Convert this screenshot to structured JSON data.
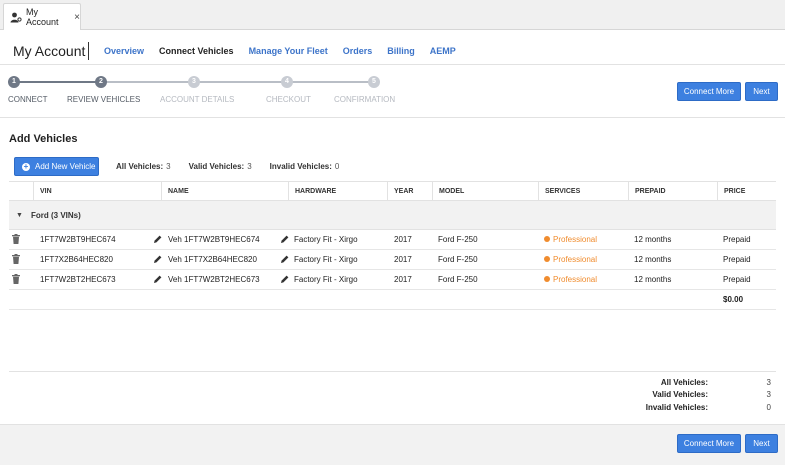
{
  "tab": {
    "label": "My Account",
    "close": "×"
  },
  "header": {
    "title": "My Account",
    "nav": [
      "Overview",
      "Connect Vehicles",
      "Manage Your Fleet",
      "Orders",
      "Billing",
      "AEMP"
    ]
  },
  "stepper": {
    "steps": [
      {
        "num": "1",
        "label": "CONNECT"
      },
      {
        "num": "2",
        "label": "REVIEW VEHICLES"
      },
      {
        "num": "3",
        "label": "ACCOUNT DETAILS"
      },
      {
        "num": "4",
        "label": "CHECKOUT"
      },
      {
        "num": "5",
        "label": "CONFIRMATION"
      }
    ]
  },
  "actions": {
    "connect_more": "Connect More",
    "next": "Next"
  },
  "section": {
    "title": "Add Vehicles",
    "add_button": "Add New Vehicle",
    "counts": {
      "all_label": "All Vehicles:",
      "all": "3",
      "valid_label": "Valid Vehicles:",
      "valid": "3",
      "invalid_label": "Invalid Vehicles:",
      "invalid": "0"
    }
  },
  "table": {
    "headers": [
      "VIN",
      "NAME",
      "HARDWARE",
      "YEAR",
      "MODEL",
      "SERVICES",
      "PREPAID",
      "PRICE"
    ],
    "group": "Ford (3 VINs)",
    "rows": [
      {
        "vin": "1FT7W2BT9HEC674",
        "name": "Veh 1FT7W2BT9HEC674",
        "hardware": "Factory Fit - Xirgo",
        "year": "2017",
        "model": "Ford F-250",
        "services": "Professional",
        "prepaid": "12 months",
        "price": "Prepaid"
      },
      {
        "vin": "1FT7X2B64HEC820",
        "name": "Veh 1FT7X2B64HEC820",
        "hardware": "Factory Fit - Xirgo",
        "year": "2017",
        "model": "Ford F-250",
        "services": "Professional",
        "prepaid": "12 months",
        "price": "Prepaid"
      },
      {
        "vin": "1FT7W2BT2HEC673",
        "name": "Veh 1FT7W2BT2HEC673",
        "hardware": "Factory Fit - Xirgo",
        "year": "2017",
        "model": "Ford F-250",
        "services": "Professional",
        "prepaid": "12 months",
        "price": "Prepaid"
      }
    ],
    "total": "$0.00"
  },
  "summary": {
    "all_label": "All Vehicles:",
    "all": "3",
    "valid_label": "Valid Vehicles:",
    "valid": "3",
    "invalid_label": "Invalid Vehicles:",
    "invalid": "0"
  },
  "colors": {
    "accent": "#3d80e0",
    "nav_link": "#3d74c9",
    "service": "#f08c2e"
  }
}
